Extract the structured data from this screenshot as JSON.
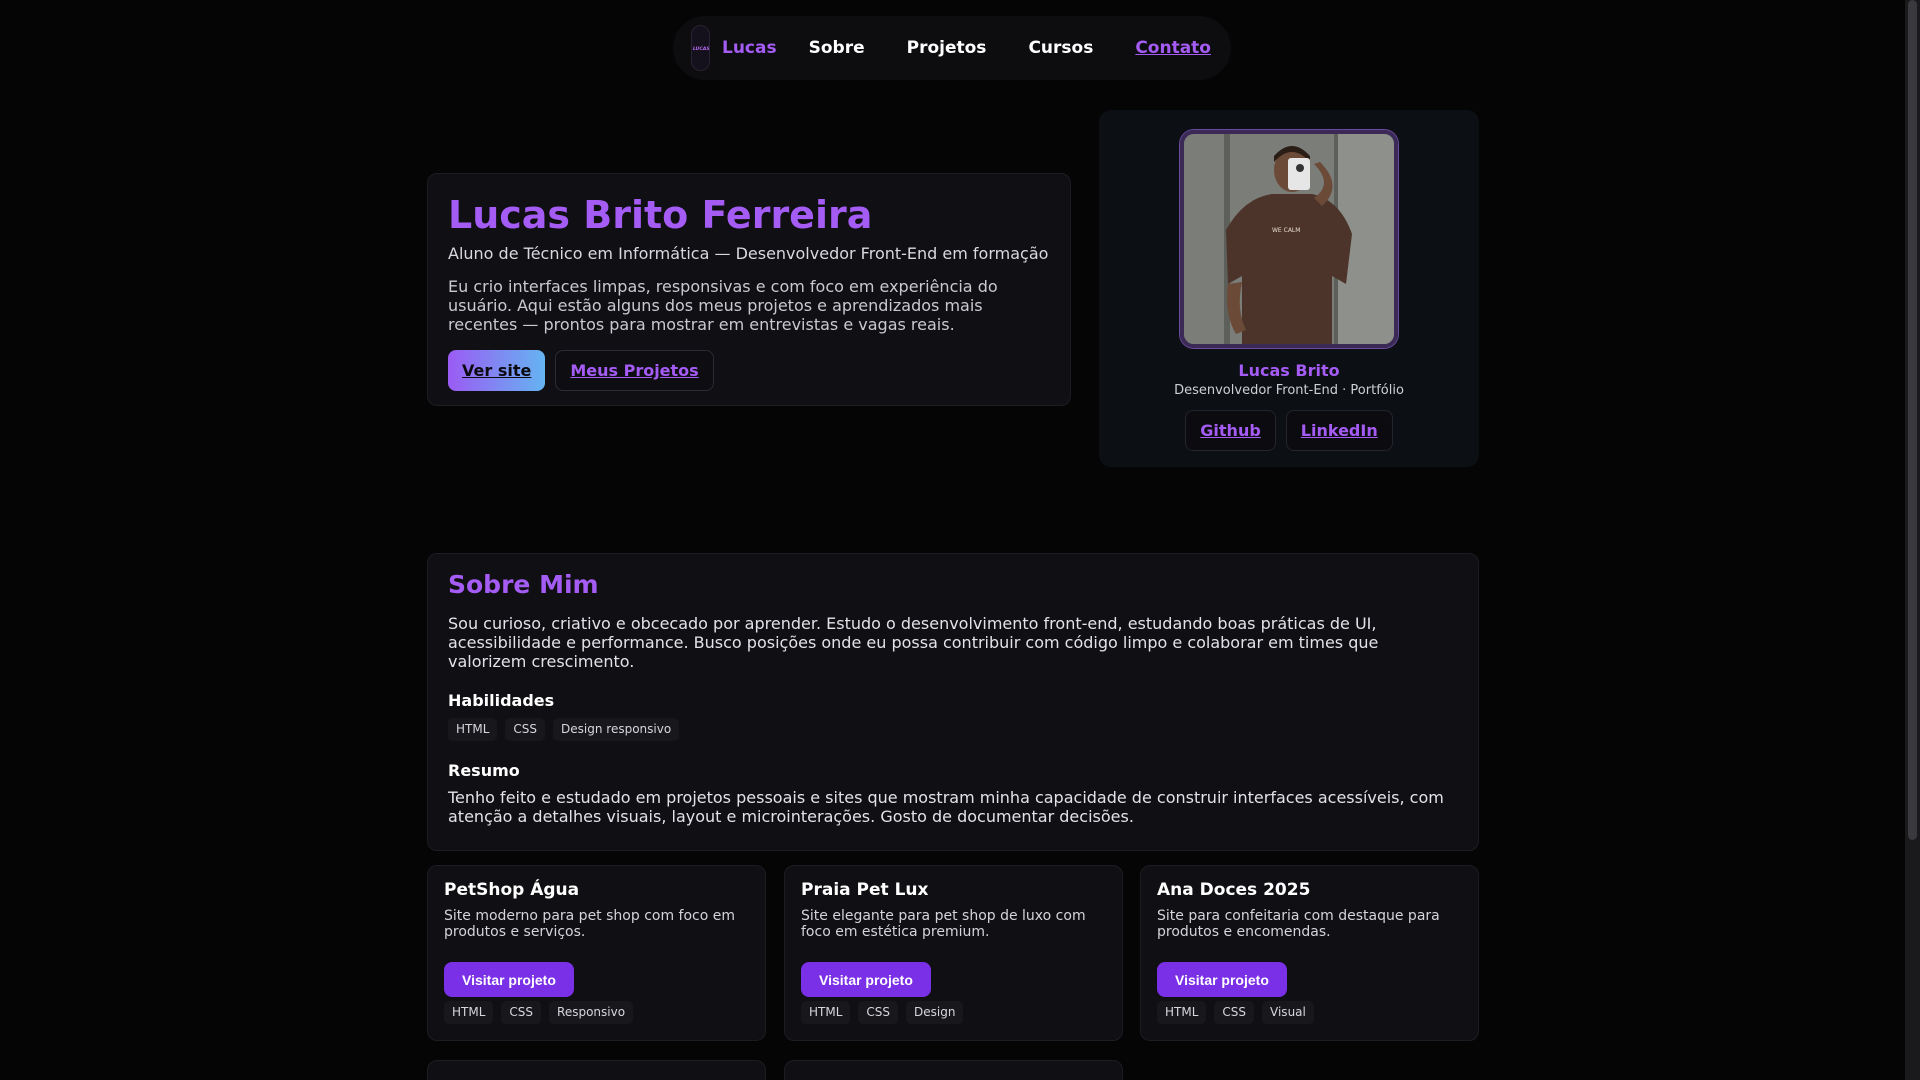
{
  "nav": {
    "logo_text": "LUCAS B",
    "brand": "Lucas",
    "links": [
      "Sobre",
      "Projetos",
      "Cursos",
      "Contato"
    ]
  },
  "hero": {
    "name": "Lucas Brito Ferreira",
    "subtitle": "Aluno de Técnico em Informática — Desenvolvedor Front-End em formação",
    "description": "Eu crio interfaces limpas, responsivas e com foco em experiência do usuário. Aqui estão alguns dos meus projetos e aprendizados mais recentes — prontos para mostrar em entrevistas e vagas reais.",
    "primary_button": "Ver site",
    "secondary_button": "Meus Projetos"
  },
  "profile": {
    "name": "Lucas Brito",
    "role": "Desenvolvedor Front-End · Portfólio",
    "links": [
      "Github",
      "LinkedIn"
    ]
  },
  "about": {
    "title": "Sobre Mim",
    "intro": "Sou curioso, criativo e obcecado por aprender. Estudo o desenvolvimento front-end, estudando boas práticas de UI, acessibilidade e performance. Busco posições onde eu possa contribuir com código limpo e colaborar em times que valorizem crescimento.",
    "skills_title": "Habilidades",
    "skills": [
      "HTML",
      "CSS",
      "Design responsivo"
    ],
    "summary_title": "Resumo",
    "summary": "Tenho feito e estudado em projetos pessoais e sites que mostram minha capacidade de construir interfaces acessíveis, com atenção a detalhes visuais, layout e microinterações. Gosto de documentar decisões."
  },
  "projects": [
    {
      "title": "PetShop Água",
      "description": "Site moderno para pet shop com foco em produtos e serviços.",
      "button": "Visitar projeto",
      "tags": [
        "HTML",
        "CSS",
        "Responsivo"
      ]
    },
    {
      "title": "Praia Pet Lux",
      "description": "Site elegante para pet shop de luxo com foco em estética premium.",
      "button": "Visitar projeto",
      "tags": [
        "HTML",
        "CSS",
        "Design"
      ]
    },
    {
      "title": "Ana Doces 2025",
      "description": "Site para confeitaria com destaque para produtos e encomendas.",
      "button": "Visitar projeto",
      "tags": [
        "HTML",
        "CSS",
        "Visual"
      ]
    }
  ],
  "accent_color": "#a45cf5",
  "button_color": "#7a30e6"
}
